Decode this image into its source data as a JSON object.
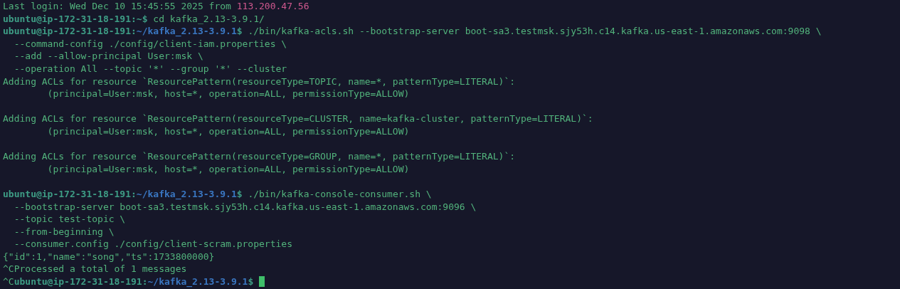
{
  "terminal": {
    "lines": [
      {
        "kind": "line",
        "segments": [
          {
            "kind": "text",
            "text": "Last login: Wed Dec 10 15:45:55 2025 from "
          },
          {
            "kind": "host",
            "text": "113.200.47.56"
          }
        ]
      },
      {
        "kind": "line",
        "segments": [
          {
            "kind": "prompt",
            "text": "ubuntu@ip-172-31-18-191:~$"
          },
          {
            "kind": "text",
            "text": " cd kafka_2.13-3.9.1/"
          }
        ]
      },
      {
        "kind": "line",
        "segments": [
          {
            "kind": "prompt",
            "text": "ubuntu@ip-172-31-18-191:"
          },
          {
            "kind": "path",
            "text": "~/kafka_2.13-3.9.1"
          },
          {
            "kind": "prompt",
            "text": "$"
          },
          {
            "kind": "text",
            "text": " ./bin/kafka-acls.sh --bootstrap-server boot-sa3.testmsk.sjy53h.c14.kafka.us-east-1.amazonaws.com:9098 \\"
          }
        ]
      },
      {
        "kind": "line",
        "segments": [
          {
            "kind": "text",
            "text": "  --command-config ./config/client-iam.properties \\"
          }
        ]
      },
      {
        "kind": "line",
        "segments": [
          {
            "kind": "text",
            "text": "  --add --allow-principal User:msk \\"
          }
        ]
      },
      {
        "kind": "line",
        "segments": [
          {
            "kind": "text",
            "text": "  --operation All --topic '*' --group '*' --cluster"
          }
        ]
      },
      {
        "kind": "line",
        "segments": [
          {
            "kind": "text",
            "text": "Adding ACLs for resource `ResourcePattern(resourceType=TOPIC, name=*, patternType=LITERAL)`:"
          }
        ]
      },
      {
        "kind": "line",
        "segments": [
          {
            "kind": "text",
            "text": "        (principal=User:msk, host=*, operation=ALL, permissionType=ALLOW)"
          }
        ]
      },
      {
        "kind": "blank"
      },
      {
        "kind": "line",
        "segments": [
          {
            "kind": "text",
            "text": "Adding ACLs for resource `ResourcePattern(resourceType=CLUSTER, name=kafka-cluster, patternType=LITERAL)`:"
          }
        ]
      },
      {
        "kind": "line",
        "segments": [
          {
            "kind": "text",
            "text": "        (principal=User:msk, host=*, operation=ALL, permissionType=ALLOW)"
          }
        ]
      },
      {
        "kind": "blank"
      },
      {
        "kind": "line",
        "segments": [
          {
            "kind": "text",
            "text": "Adding ACLs for resource `ResourcePattern(resourceType=GROUP, name=*, patternType=LITERAL)`:"
          }
        ]
      },
      {
        "kind": "line",
        "segments": [
          {
            "kind": "text",
            "text": "        (principal=User:msk, host=*, operation=ALL, permissionType=ALLOW)"
          }
        ]
      },
      {
        "kind": "blank"
      },
      {
        "kind": "line",
        "segments": [
          {
            "kind": "prompt",
            "text": "ubuntu@ip-172-31-18-191:"
          },
          {
            "kind": "path",
            "text": "~/kafka_2.13-3.9.1"
          },
          {
            "kind": "prompt",
            "text": "$"
          },
          {
            "kind": "text",
            "text": " ./bin/kafka-console-consumer.sh \\"
          }
        ]
      },
      {
        "kind": "line",
        "segments": [
          {
            "kind": "text",
            "text": "  --bootstrap-server boot-sa3.testmsk.sjy53h.c14.kafka.us-east-1.amazonaws.com:9096 \\"
          }
        ]
      },
      {
        "kind": "line",
        "segments": [
          {
            "kind": "text",
            "text": "  --topic test-topic \\"
          }
        ]
      },
      {
        "kind": "line",
        "segments": [
          {
            "kind": "text",
            "text": "  --from-beginning \\"
          }
        ]
      },
      {
        "kind": "line",
        "segments": [
          {
            "kind": "text",
            "text": "  --consumer.config ./config/client-scram.properties"
          }
        ]
      },
      {
        "kind": "line",
        "segments": [
          {
            "kind": "text",
            "text": "{\"id\":1,\"name\":\"song\",\"ts\":1733800000}"
          }
        ]
      },
      {
        "kind": "line",
        "segments": [
          {
            "kind": "text",
            "text": "^CProcessed a total of 1 messages"
          }
        ]
      },
      {
        "kind": "line",
        "segments": [
          {
            "kind": "text",
            "text": "^C"
          },
          {
            "kind": "prompt",
            "text": "ubuntu@ip-172-31-18-191:"
          },
          {
            "kind": "path",
            "text": "~/kafka_2.13-3.9.1"
          },
          {
            "kind": "prompt",
            "text": "$"
          },
          {
            "kind": "cursor"
          }
        ]
      }
    ]
  }
}
